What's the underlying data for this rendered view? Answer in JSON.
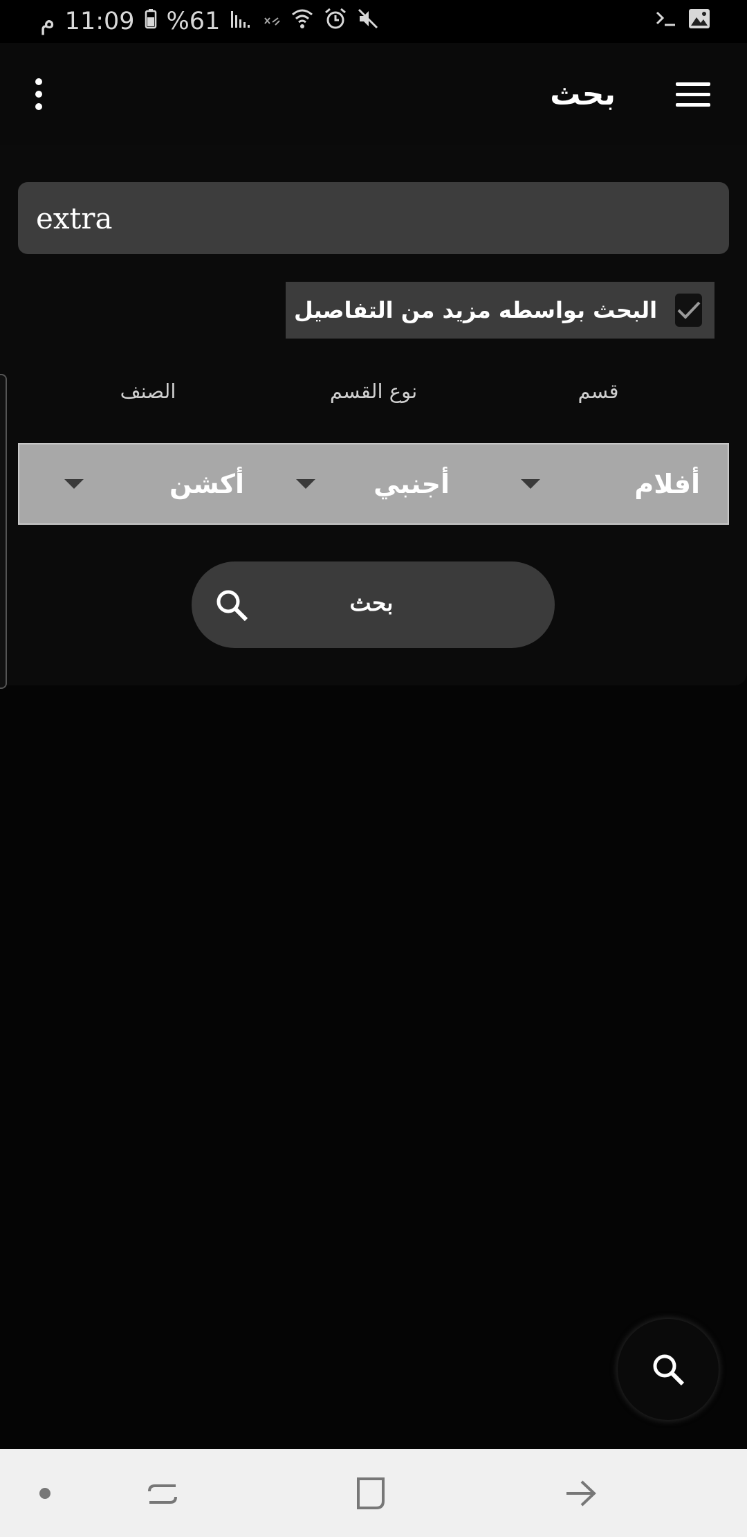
{
  "status_bar": {
    "time": "11:09",
    "period": "م",
    "battery": "%61"
  },
  "app_bar": {
    "title": "بحث",
    "menu_icon": "hamburger-menu-icon",
    "overflow_icon": "more-vert-icon"
  },
  "search": {
    "input_value": "extra",
    "detail_checkbox_label": "البحث بواسطه مزيد من التفاصيل",
    "detail_checked": true
  },
  "filters": {
    "labels": [
      "قسم",
      "نوع القسم",
      "الصنف"
    ],
    "values": [
      "أفلام",
      "أجنبي",
      "أكشن"
    ]
  },
  "search_button": {
    "label": "بحث",
    "icon": "search-icon"
  },
  "fab": {
    "icon": "search-icon"
  },
  "nav_bar": {
    "items": [
      "dot-icon",
      "recents-icon",
      "home-icon",
      "back-icon"
    ]
  },
  "colors": {
    "background": "#050505",
    "input": "#3d3d3d",
    "dropdown_bar": "#a8a8a8",
    "nav_bar": "#f0f0f0"
  }
}
